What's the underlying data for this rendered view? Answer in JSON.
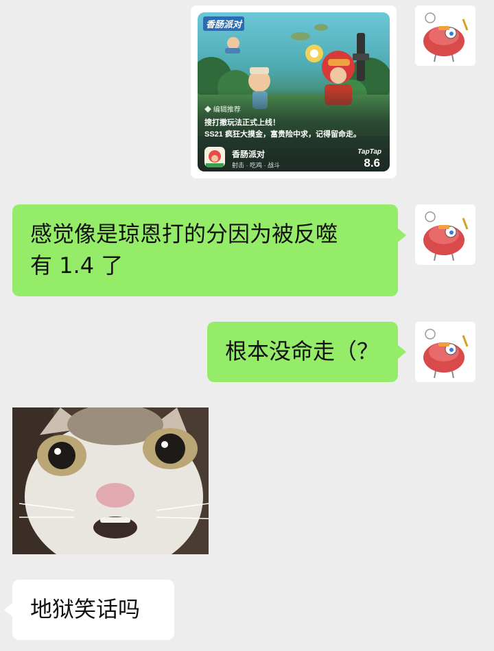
{
  "card": {
    "logo_text": "香肠派对",
    "editor_tag": "编辑推荐",
    "headline": "搜打撤玩法正式上线！",
    "subline": "SS21 疯狂大摸金，富贵险中求，记得留命走。",
    "app_name": "香肠派对",
    "app_tags": "射击 · 吃鸡 · 战斗",
    "brand": "TapTap",
    "score": "8.6"
  },
  "messages": [
    {
      "side": "right",
      "text_line1": "感觉像是琼恩打的分因为被反噬",
      "text_line2": "有 1.4 了"
    },
    {
      "side": "right",
      "text": "根本没命走（？"
    },
    {
      "side": "left",
      "text": "地狱笑话吗"
    }
  ],
  "colors": {
    "background": "#ededed",
    "bubble_self": "#95ec69",
    "bubble_other": "#ffffff"
  }
}
